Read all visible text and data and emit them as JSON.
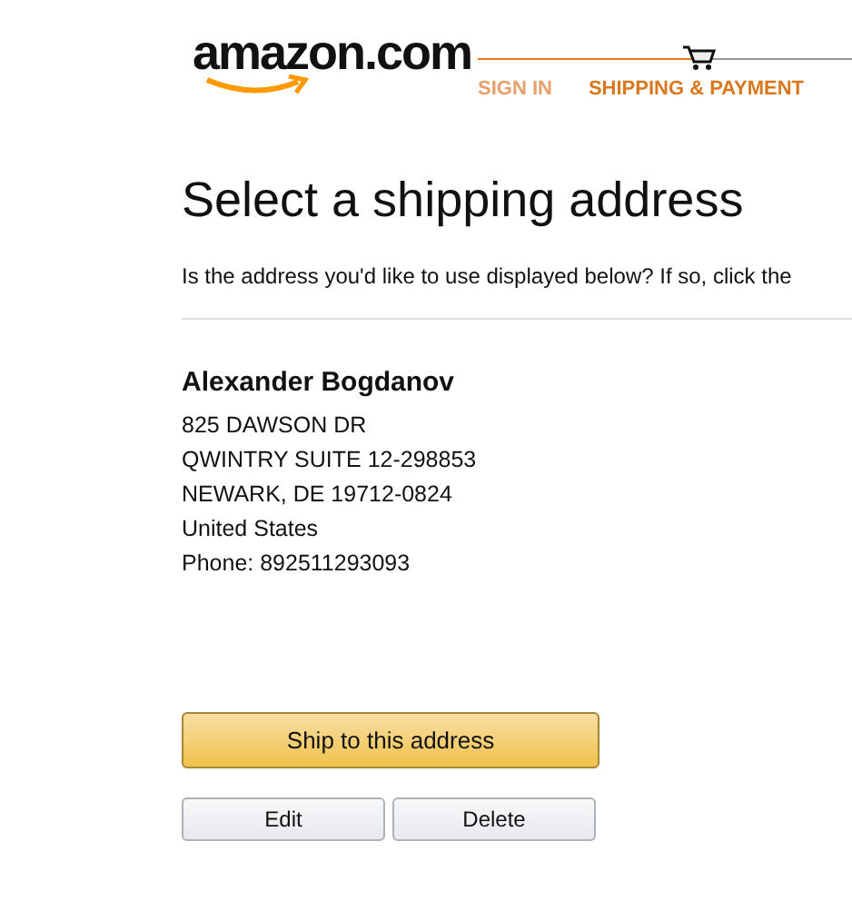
{
  "header": {
    "logo": "amazon.com",
    "steps": [
      {
        "label": "SIGN IN",
        "selected": false
      },
      {
        "label": "SHIPPING & PAYMENT",
        "selected": true
      }
    ]
  },
  "title": "Select a shipping address",
  "intro": "Is the address you'd like to use displayed below? If so, click the",
  "address": {
    "name": "Alexander Bogdanov",
    "lines": [
      "825 DAWSON DR",
      "QWINTRY SUITE 12-298853",
      "NEWARK, DE 19712-0824",
      "United States",
      "Phone: 892511293093"
    ]
  },
  "primary_button": "Ship to this address",
  "buttons": [
    "Edit",
    "Delete"
  ]
}
